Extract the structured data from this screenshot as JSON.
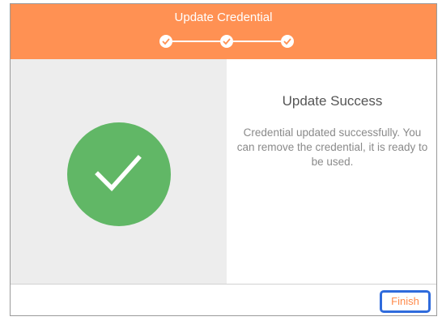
{
  "header": {
    "title": "Update Credential",
    "steps": [
      {
        "icon": "check-icon",
        "state": "complete"
      },
      {
        "icon": "check-icon",
        "state": "complete"
      },
      {
        "icon": "check-icon",
        "state": "complete"
      }
    ],
    "background_color": "#ff9153"
  },
  "left_pane": {
    "icon": "check-icon",
    "circle_color": "#61b766"
  },
  "right_pane": {
    "title": "Update Success",
    "message": "Credential updated successfully. You can remove the credential, it is ready to be used."
  },
  "footer": {
    "finish_label": "Finish",
    "finish_focus_color": "#2f6bdc"
  }
}
